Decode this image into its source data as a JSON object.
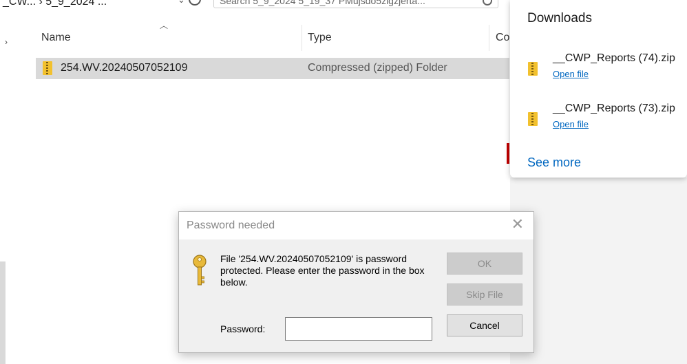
{
  "explorer": {
    "breadcrumb": "_CW... ›  5_9_2024 ...",
    "search_placeholder": "Search 5_9_2024 5_19_37 PMujsdo5zigzjerta...",
    "columns": {
      "name": "Name",
      "type": "Type",
      "co": "Co"
    },
    "file": {
      "name": "254.WV.20240507052109",
      "type": "Compressed (zipped) Folder"
    }
  },
  "downloads": {
    "title": "Downloads",
    "items": [
      {
        "name": "__CWP_Reports (74).zip",
        "action": "Open file"
      },
      {
        "name": "__CWP_Reports (73).zip",
        "action": "Open file"
      }
    ],
    "see_more": "See more"
  },
  "dialog": {
    "title": "Password needed",
    "message": "File '254.WV.20240507052109' is password protected.  Please enter the password in the box below.",
    "ok": "OK",
    "skip": "Skip File",
    "cancel": "Cancel",
    "password_label": "Password:",
    "password_value": ""
  },
  "colors": {
    "link": "#0067c0",
    "accent_red": "#c00000",
    "folder_zip": "#f2c12e"
  },
  "icons": [
    "refresh-icon",
    "search-icon",
    "zip-folder-icon",
    "key-icon",
    "close-icon"
  ]
}
